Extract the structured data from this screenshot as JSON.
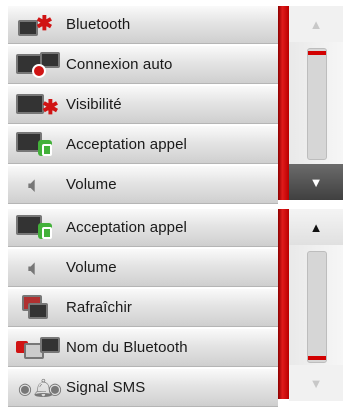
{
  "panel_top": {
    "items": [
      {
        "label": "Bluetooth",
        "icon": "bluetooth-icon"
      },
      {
        "label": "Connexion auto",
        "icon": "auto-connect-icon"
      },
      {
        "label": "Visibilité",
        "icon": "visibility-icon"
      },
      {
        "label": "Acceptation appel",
        "icon": "call-accept-icon"
      },
      {
        "label": "Volume",
        "icon": "volume-icon"
      }
    ],
    "scroll_up": "▲",
    "scroll_down": "▼",
    "scroll_position": 0
  },
  "panel_bottom": {
    "items": [
      {
        "label": "Acceptation appel",
        "icon": "call-accept-icon"
      },
      {
        "label": "Volume",
        "icon": "volume-icon"
      },
      {
        "label": "Rafraîchir",
        "icon": "refresh-icon"
      },
      {
        "label": "Nom du Bluetooth",
        "icon": "bluetooth-name-icon"
      },
      {
        "label": "Signal SMS",
        "icon": "sms-signal-icon"
      }
    ],
    "scroll_up": "▲",
    "scroll_down": "▼",
    "scroll_position": 1
  },
  "colors": {
    "accent_red": "#d20000",
    "row_bg": "#e4e4e4"
  }
}
